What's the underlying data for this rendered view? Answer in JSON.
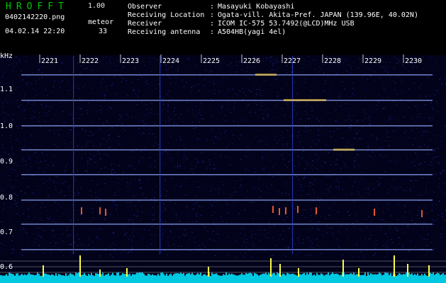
{
  "header": {
    "app_title": "HROFFT",
    "app_version": "1.00",
    "file_name": "0402142220.png",
    "datetime": "04.02.14 22:20",
    "meteor_label": "meteor",
    "meteor_count": "33"
  },
  "station_info": [
    {
      "label": "Observer",
      "value": "Masayuki Kobayashi"
    },
    {
      "label": "Receiving Location",
      "value": "Ogata-vill. Akita-Pref. JAPAN (139.96E, 40.02N)"
    },
    {
      "label": "Receiver",
      "value": "ICOM IC-575 53.7492(@LCD)MHz USB"
    },
    {
      "label": "Receiving antenna",
      "value": "A504HB(yagi 4el)"
    }
  ],
  "spectrogram": {
    "unit_label": "kHz",
    "time_labels": [
      "2221",
      "2222",
      "2223",
      "2224",
      "2225",
      "2226",
      "2227",
      "2228",
      "2229",
      "2230"
    ],
    "freq_labels": [
      "1.1",
      "1.0",
      "0.9",
      "0.8",
      "0.7",
      "0.6"
    ],
    "colors": {
      "background": "#02021a",
      "noise": "#2a3cc8",
      "signal": "#8fa8ff",
      "hot": "#ff6030",
      "hot2": "#ffd040",
      "histogram_fill": "#00c8e0",
      "histogram_peak": "#ffff40",
      "grid": "#c8c8c8"
    }
  }
}
